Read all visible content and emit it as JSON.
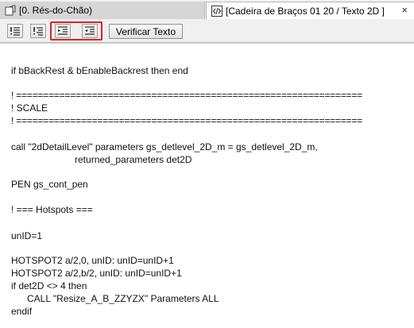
{
  "tabs": [
    {
      "label": "[0. Rés-do-Chão)"
    },
    {
      "label": "[Cadeira de Braços 01 20 / Texto 2D ]",
      "close": "×"
    }
  ],
  "toolbar": {
    "verify_label": "Verificar Texto"
  },
  "code": {
    "line1": "if bBackRest & bEnableBackrest then end",
    "line2": "! ================================================================",
    "line3": "! SCALE",
    "line4": "! ================================================================",
    "line5": "call \"2dDetailLevel\" parameters gs_detlevel_2D_m = gs_detlevel_2D_m,",
    "line6": "                        returned_parameters det2D",
    "line7": "PEN gs_cont_pen",
    "line8": "! === Hotspots ===",
    "line9": "unID=1",
    "line10": "HOTSPOT2 a/2,0, unID: unID=unID+1",
    "line11": "HOTSPOT2 a/2,b/2, unID: unID=unID+1",
    "line12": "if det2D <> 4 then",
    "line13": "      CALL \"Resize_A_B_ZZYZX\" Parameters ALL",
    "line14": "endif"
  },
  "icons": {
    "tab1": "view-icon",
    "tab2": "gdl-script-icon",
    "btn1": "comment-icon",
    "btn2": "uncomment-icon",
    "btn3": "indent-icon",
    "btn4": "outdent-icon"
  },
  "colors": {
    "highlight": "#e02020"
  }
}
